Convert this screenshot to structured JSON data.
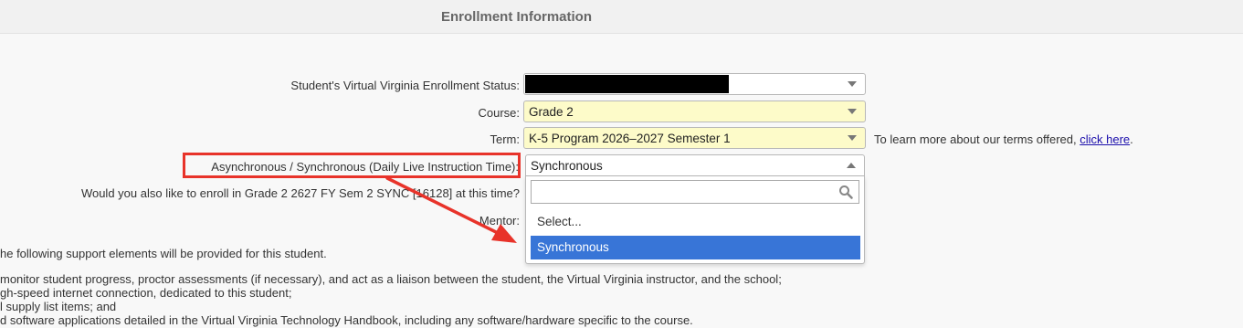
{
  "header": {
    "title": "Enrollment Information"
  },
  "form": {
    "enrollment_status_label": "Student's Virtual Virginia Enrollment Status:",
    "course_label": "Course:",
    "course_value": "Grade 2",
    "term_label": "Term:",
    "term_value": "K-5 Program 2026–2027 Semester 1",
    "terms_note_prefix": "To learn more about our terms offered, ",
    "terms_link": "click here",
    "terms_note_suffix": ".",
    "sync_label": "Asynchronous / Synchronous (Daily Live Instruction Time):",
    "sync_value": "Synchronous",
    "enroll_question": "Would you also like to enroll in Grade 2 2627 FY Sem 2 SYNC [16128] at this time?",
    "mentor_label": "Mentor:"
  },
  "dropdown": {
    "search_value": "",
    "options": [
      "Select...",
      "Synchronous"
    ]
  },
  "support": {
    "intro": "he following support elements will be provided for this student.",
    "items": [
      "monitor student progress, proctor assessments (if necessary), and act as a liaison between the student, the Virtual Virginia instructor, and the school;",
      "gh-speed internet connection, dedicated to this student;",
      "l supply list items; and",
      "d software applications detailed in the Virtual Virginia Technology Handbook, including any software/hardware specific to the course."
    ]
  },
  "colors": {
    "annotation": "#e8332a",
    "highlight": "#3875d7",
    "yellow_field": "#fdfbc9"
  }
}
